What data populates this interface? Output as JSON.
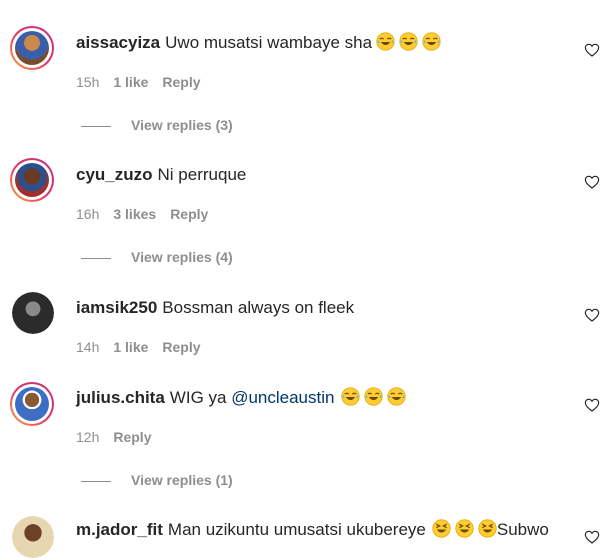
{
  "comments": [
    {
      "user": "aissacyiza",
      "text": "Uwo musatsi wambaye sha",
      "time": "15h",
      "likes": "1 like",
      "reply": "Reply",
      "view_replies": "View replies (3)"
    },
    {
      "user": "cyu_zuzo",
      "text": "Ni perruque",
      "time": "16h",
      "likes": "3 likes",
      "reply": "Reply",
      "view_replies": "View replies (4)"
    },
    {
      "user": "iamsik250",
      "text": "Bossman always on fleek",
      "time": "14h",
      "likes": "1 like",
      "reply": "Reply"
    },
    {
      "user": "julius.chita",
      "text": "WIG ya",
      "mention": "@uncleaustin",
      "time": "12h",
      "reply": "Reply",
      "view_replies": "View replies (1)"
    },
    {
      "user": "m.jador_fit",
      "text": "Man uzikuntu umusatsi ukubereye",
      "text_after": "Subwo"
    }
  ],
  "icons": {
    "like": "heart-outline-icon",
    "laugh": "tears-of-joy-emoji",
    "grin": "squinting-laugh-emoji"
  },
  "colors": {
    "accent_ring": "#e1306c",
    "mention": "#00376b",
    "muted": "#8e8e8e",
    "text": "#262626"
  }
}
